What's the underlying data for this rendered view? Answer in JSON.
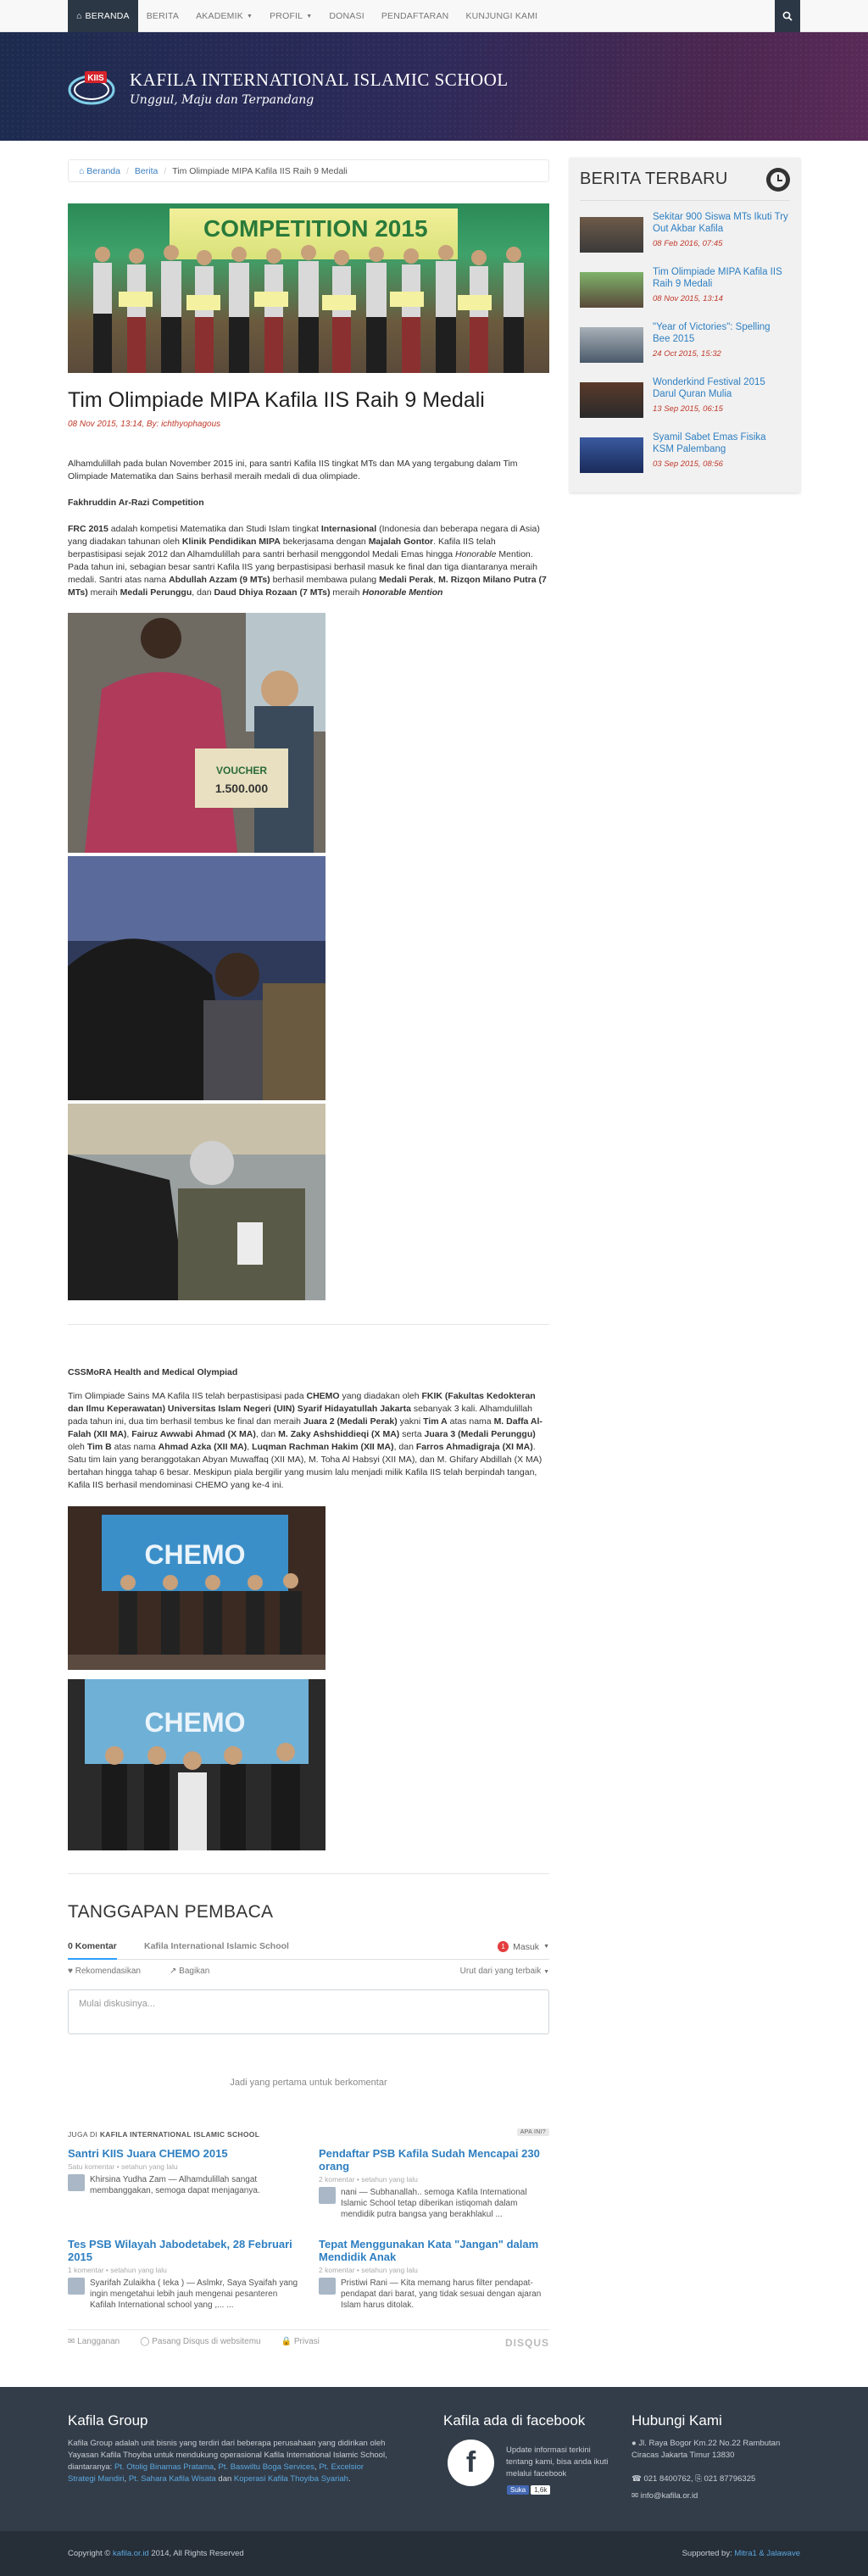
{
  "nav": {
    "items": [
      {
        "label": "BERANDA",
        "icon": "home-icon",
        "active": true
      },
      {
        "label": "BERITA"
      },
      {
        "label": "AKADEMIK",
        "caret": true
      },
      {
        "label": "PROFIL",
        "caret": true
      },
      {
        "label": "DONASI"
      },
      {
        "label": "PENDAFTARAN"
      },
      {
        "label": "KUNJUNGI KAMI"
      }
    ],
    "search_icon": "search-icon"
  },
  "header": {
    "title": "KAFILA INTERNATIONAL ISLAMIC SCHOOL",
    "motto": "Unggul, Maju dan Terpandang",
    "logo_text": "KIIS"
  },
  "breadcrumb": [
    "Beranda",
    "Berita",
    "Tim Olimpiade MIPA Kafila IIS Raih 9 Medali"
  ],
  "hero": {
    "sign_text": "COMPETITION 2015"
  },
  "article": {
    "title": "Tim Olimpiade MIPA Kafila IIS Raih 9 Medali",
    "meta": "08 Nov 2015, 13:14, By: ichthyophagous",
    "intro": "Alhamdulillah pada bulan November 2015 ini, para santri Kafila IIS tingkat MTs dan MA yang tergabung dalam Tim Olimpiade Matematika dan Sains berhasil meraih medali di dua olimpiade.",
    "section1_title": "Fakhruddin Ar-Razi Competition",
    "section1_body": {
      "s1": "FRC 2015",
      "s2": " adalah kompetisi Matematika dan Studi Islam tingkat ",
      "s3": "Internasional",
      "s4": " (Indonesia dan beberapa negara di Asia) yang diadakan tahunan oleh ",
      "s5": "Klinik Pendidikan MIPA",
      "s6": " bekerjasama dengan ",
      "s7": "Majalah Gontor",
      "s8": ". Kafila IIS telah berpastisipasi sejak 2012 dan Alhamdulillah para santri berhasil menggondol Medali Emas hingga ",
      "s9": "Honorable",
      "s10": " Mention. Pada tahun ini, sebagian besar santri Kafila IIS yang berpastisipasi berhasil masuk ke final dan tiga diantaranya meraih medali. Santri atas nama ",
      "s11": "Abdullah Azzam (9 MTs)",
      "s12": " berhasil membawa pulang ",
      "s13": "Medali Perak",
      "s14": ", ",
      "s15": "M. Rizqon Milano Putra (7 MTs)",
      "s16": " meraih ",
      "s17": "Medali Perunggu",
      "s18": ", dan ",
      "s19": "Daud Dhiya Rozaan (7 MTs)",
      "s20": " meraih ",
      "s21": "Honorable Mention"
    },
    "section2_title": "CSSMoRA Health and Medical Olympiad",
    "section2_body": {
      "s1": " Tim Olimpiade Sains MA Kafila IIS telah berpastisipasi pada ",
      "s2": "CHEMO",
      "s3": " yang diadakan oleh ",
      "s4": "FKIK (Fakultas Kedokteran dan Ilmu Keperawatan) Universitas Islam Negeri (UIN) Syarif Hidayatullah Jakarta",
      "s5": " sebanyak 3 kali. Alhamdulillah pada tahun ini, dua tim berhasil tembus ke final dan meraih ",
      "s6": "Juara 2 (Medali Perak)",
      "s7": " yakni ",
      "s8": "Tim A",
      "s9": " atas nama ",
      "s10": "M. Daffa Al-Falah (XII MA)",
      "s11": ", ",
      "s12": "Fairuz Awwabi Ahmad (X MA)",
      "s13": ", dan ",
      "s14": "M. Zaky Ashshiddieqi (X MA)",
      "s15": " serta ",
      "s16": "Juara 3 (Medali Perunggu)",
      "s17": " oleh ",
      "s18": "Tim B",
      "s19": " atas nama ",
      "s20": "Ahmad Azka (XII MA)",
      "s21": ", ",
      "s22": "Luqman Rachman Hakim (XII MA)",
      "s23": ", dan ",
      "s24": "Farros Ahmadigraja (XI MA)",
      "s25": ".  Satu tim lain yang beranggotakan Abyan Muwaffaq (XII MA), M. Toha Al Habsyi (XII MA), dan M. Ghifary Abdillah (X MA) bertahan hingga tahap 6 besar. Meskipun piala bergilir yang musim lalu menjadi milik Kafila IIS telah berpindah tangan, Kafila IIS berhasil mendominasi  CHEMO yang ke-4 ini."
    },
    "photo_texts": {
      "voucher": "VOUCHER",
      "amount": "1.500.000",
      "chemo": "CHEMO"
    }
  },
  "sidebar": {
    "title": "BERITA TERBARU",
    "items": [
      {
        "title": "Sekitar 900 Siswa MTs Ikuti Try Out Akbar Kafila",
        "date": "08 Feb 2016, 07:45"
      },
      {
        "title": "Tim Olimpiade MIPA Kafila IIS Raih 9 Medali",
        "date": "08 Nov 2015, 13:14"
      },
      {
        "title": "\"Year of Victories\": Spelling Bee 2015",
        "date": "24 Oct 2015, 15:32"
      },
      {
        "title": "Wonderkind Festival 2015 Darul Quran Mulia",
        "date": "13 Sep 2015, 06:15"
      },
      {
        "title": "Syamil Sabet Emas Fisika KSM Palembang",
        "date": "03 Sep 2015, 08:56"
      }
    ]
  },
  "comments": {
    "title": "TANGGAPAN PEMBACA",
    "tab_count": "0 Komentar",
    "tab_site": "Kafila International Islamic School",
    "login": "Masuk",
    "login_badge": "1",
    "recommend": "Rekomendasikan",
    "share": "Bagikan",
    "sort": "Urut dari yang terbaik",
    "placeholder": "Mulai diskusinya...",
    "empty": "Jadi yang pertama untuk berkomentar",
    "also_prefix": "JUGA DI ",
    "also_site": "KAFILA INTERNATIONAL ISLAMIC SCHOOL",
    "ads_label": "APA INI?",
    "recs": [
      {
        "title": "Santri KIIS Juara CHEMO 2015",
        "sub": "Satu komentar • setahun yang lalu",
        "author": "Khirsina Yudha Zam",
        "text": " — Alhamdulillah sangat membanggakan, semoga dapat menjaganya."
      },
      {
        "title": "Pendaftar PSB Kafila Sudah Mencapai 230 orang",
        "sub": "2 komentar • setahun yang lalu",
        "author": "nani",
        "text": " — Subhanallah.. semoga Kafila International Islamic School tetap diberikan istiqomah dalam mendidik putra bangsa yang berakhlakul ..."
      },
      {
        "title": "Tes PSB Wilayah Jabodetabek, 28 Februari 2015",
        "sub": "1 komentar • setahun yang lalu",
        "author": "Syarifah Zulaikha ( Ieka )",
        "text": " — Aslmkr, Saya Syaifah yang ingin mengetahui lebih jauh mengenai pesanteren Kafilah International school yang ,... ..."
      },
      {
        "title": "Tepat Menggunakan Kata \"Jangan\" dalam Mendidik Anak",
        "sub": "2 komentar • setahun yang lalu",
        "author": "Pristiwi Rani",
        "text": " — Kita memang harus filter pendapat-pendapat dari barat, yang tidak sesuai dengan ajaran Islam harus ditolak."
      }
    ],
    "footer": [
      "Langganan",
      "Pasang Disqus di websitemu",
      "Privasi"
    ],
    "brand": "DISQUS"
  },
  "footer": {
    "group_title": "Kafila Group",
    "group_text": "Kafila Group adalah unit bisnis yang terdiri dari beberapa perusahaan yang didirikan oleh Yayasan Kafila Thoyiba untuk mendukung operasional Kafila International Islamic School, diantaranya: ",
    "group_links": [
      "Pt. Otolig Binamas Pratama",
      "Pt. Baswiltu Boga Services",
      "Pt. Excelsior Strategi Mandiri",
      "Pt. Sahara Kafila Wisata",
      "Koperasi Kafila Thoyiba Syariah"
    ],
    "group_joins": [
      ", ",
      ", ",
      ", ",
      " dan ",
      "."
    ],
    "fb_title": "Kafila ada di facebook",
    "fb_text": "Update informasi terkini tentang kami, bisa anda ikuti melalui facebook",
    "fb_like": "Suka",
    "fb_count": "1,6k",
    "contact_title": "Hubungi Kami",
    "address": "Jl. Raya Bogor Km.22 No.22 Rambutan Ciracas Jakarta Timur 13830",
    "phone": "021 8400762,",
    "fax": "021 87796325",
    "email": "info@kafila.or.id"
  },
  "copyright": {
    "left_prefix": "Copyright © ",
    "left_link": "kafila.or.id",
    "left_suffix": " 2014, All Rights Reserved",
    "right_prefix": "Supported by: ",
    "right_link": "Mitra1 & Jalawave"
  },
  "colors": {
    "accent": "#3a7ec0",
    "date": "#c0392b",
    "nav_active": "#2b3744",
    "footer": "#333d49"
  }
}
